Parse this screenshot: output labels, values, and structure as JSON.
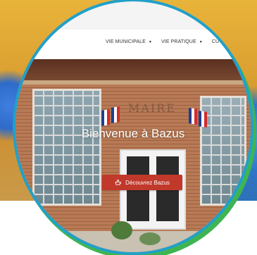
{
  "nav": {
    "items": [
      {
        "label": "VIE MUNICIPALE",
        "caret": "▾"
      },
      {
        "label": "VIE PRATIQUE",
        "caret": "▾"
      },
      {
        "label": "CU"
      }
    ]
  },
  "hero": {
    "title": "Bienvenue à Bazus",
    "plaque": "MAIRE",
    "cta_label": "Découvrez Bazus"
  },
  "colors": {
    "accent": "#c0392b",
    "ring": "#21a0c9",
    "ring_shadow": "#3fb552"
  },
  "icons": {
    "cta_icon": "pointing-hand-icon"
  }
}
